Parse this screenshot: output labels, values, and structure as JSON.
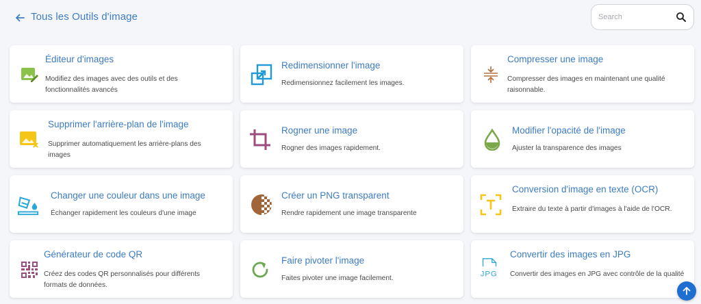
{
  "header": {
    "title": "Tous les Outils d'image",
    "search_placeholder": "Search"
  },
  "tools": [
    {
      "title": "Éditeur d'images",
      "desc": "Modifiez des images avec des outils et des fonctionnalités avancés",
      "icon": "image-edit-icon",
      "color": "#8bc34a"
    },
    {
      "title": "Redimensionner l'image",
      "desc": "Redimensionnez facilement les images.",
      "icon": "resize-icon",
      "color": "#1e9ad6"
    },
    {
      "title": "Compresser une image",
      "desc": "Compresser des images en maintenant une qualité raisonnable.",
      "icon": "compress-icon",
      "color": "#b0703c"
    },
    {
      "title": "Supprimer l'arrière-plan de l'image",
      "desc": "Supprimer automatiquement les arrière-plans des images",
      "icon": "remove-background-icon",
      "color": "#f5c518"
    },
    {
      "title": "Rogner une image",
      "desc": "Rogner des images rapidement.",
      "icon": "crop-icon",
      "color": "#9b4d7e"
    },
    {
      "title": "Modifier l'opacité de l'image",
      "desc": "Ajuster la transparence des images",
      "icon": "opacity-drop-icon",
      "color": "#7ba84a"
    },
    {
      "title": "Changer une couleur dans une image",
      "desc": "Échanger rapidement les couleurs d'une image",
      "icon": "color-change-icon",
      "color": "#2aa7d6"
    },
    {
      "title": "Créer un PNG transparent",
      "desc": "Rendre rapidement une image transparente",
      "icon": "transparent-png-icon",
      "color": "#a0663a"
    },
    {
      "title": "Conversion d'image en texte (OCR)",
      "desc": "Extraire du texte à partir d'images à l'aide de l'OCR.",
      "icon": "ocr-text-icon",
      "color": "#f5c518"
    },
    {
      "title": "Générateur de code QR",
      "desc": "Créez des codes QR personnalisés pour différents formats de données.",
      "icon": "qr-code-icon",
      "color": "#9b4d7e"
    },
    {
      "title": "Faire pivoter l'image",
      "desc": "Faites pivoter une image facilement.",
      "icon": "rotate-icon",
      "color": "#6aa84f"
    },
    {
      "title": "Convertir des images en JPG",
      "desc": "Convertir des images en JPG avec contrôle de la qualité",
      "icon": "jpg-file-icon",
      "color": "#2aa7d6"
    }
  ]
}
